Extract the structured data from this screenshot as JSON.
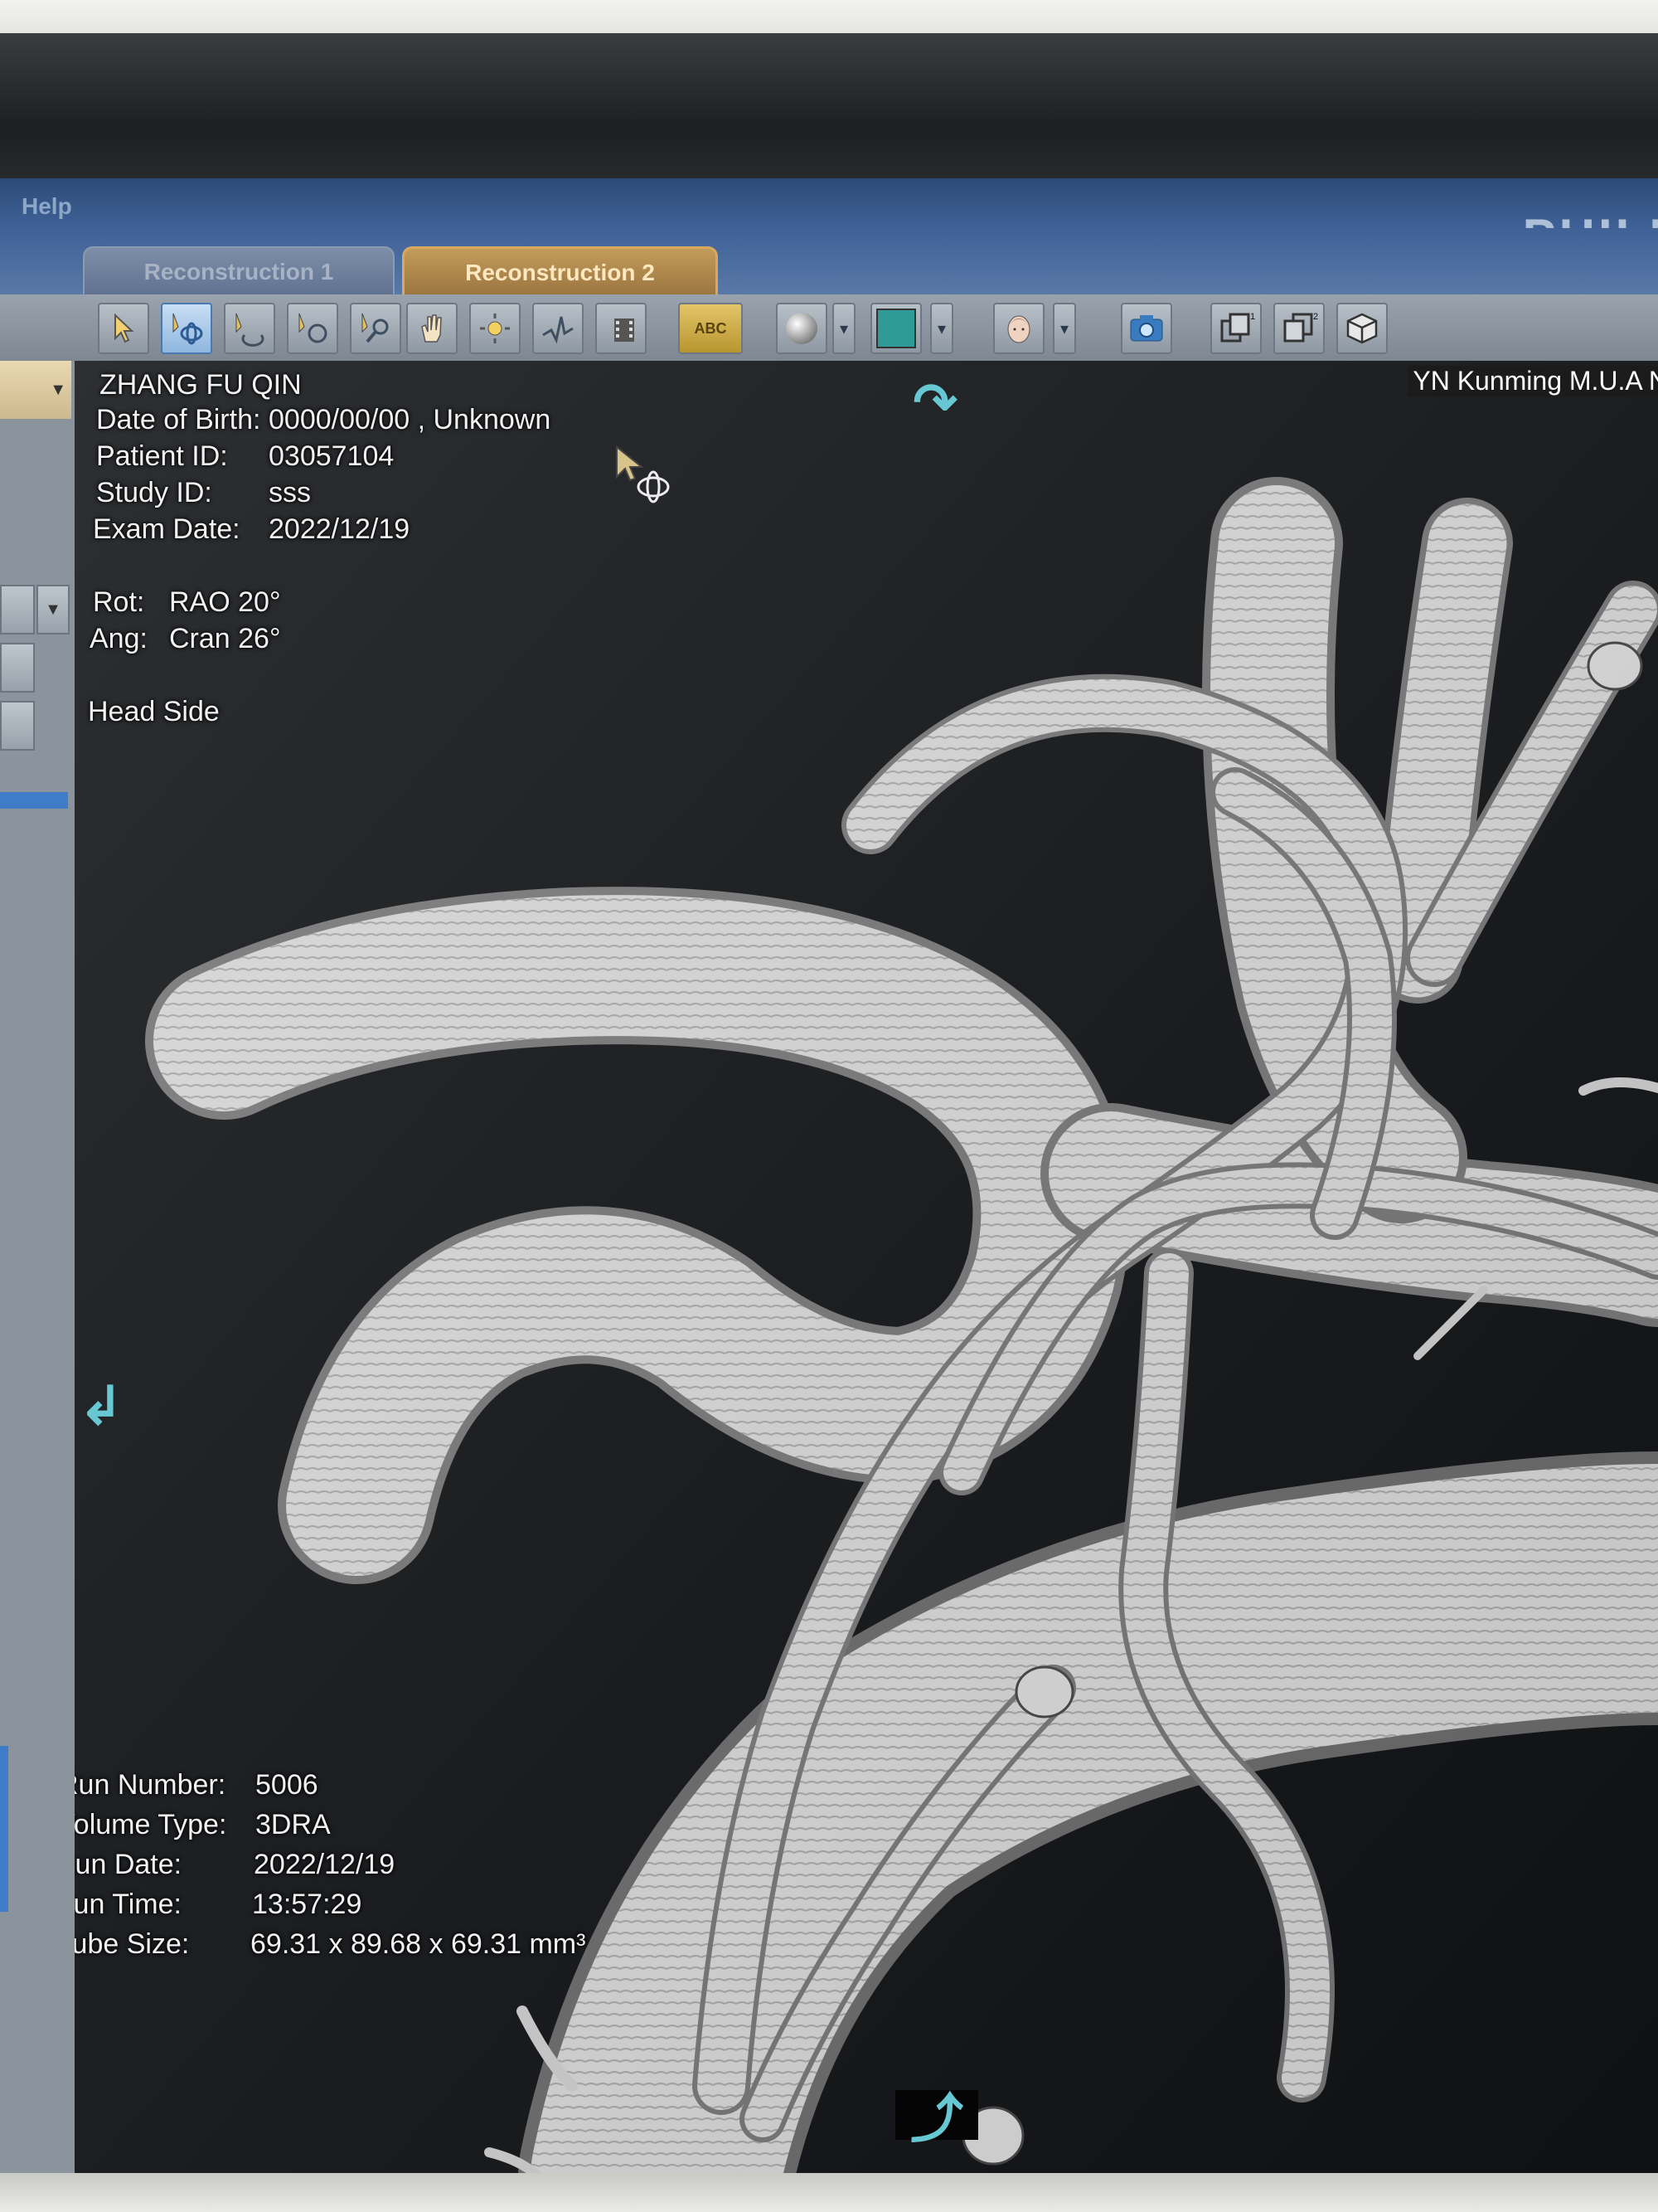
{
  "menu": {
    "help": "Help",
    "brand": "PHILI"
  },
  "tabs": [
    {
      "label": "Reconstruction 1",
      "active": false
    },
    {
      "label": "Reconstruction 2",
      "active": true
    }
  ],
  "toolbar": {
    "abc_label": "ABC",
    "icons": [
      "pointer-icon",
      "rotate-3d-icon",
      "roll-icon",
      "spin-icon",
      "zoom-icon",
      "pan-hand-icon",
      "brightness-icon",
      "measure-icon",
      "movie-icon",
      "text-annotation-icon",
      "render-sphere-icon",
      "color-swatch-icon",
      "head-orientation-icon",
      "camera-icon",
      "layout-1-icon",
      "layout-2-icon",
      "cube-icon"
    ],
    "layout_1_label": "1",
    "layout_2_label": "2",
    "accent_color": "#2f9a96"
  },
  "patient": {
    "name": "ZHANG FU QIN",
    "dob_label": "Date of Birth:",
    "dob_value": "0000/00/00 , Unknown",
    "id_label": "Patient ID:",
    "id_value": "03057104",
    "study_label": "Study ID:",
    "study_value": "sss",
    "exam_label": "Exam Date:",
    "exam_value": "2022/12/19"
  },
  "orientation": {
    "rot_label": "Rot:",
    "rot_value": "RAO  20°",
    "ang_label": "Ang:",
    "ang_value": "Cran  26°",
    "side": "Head Side"
  },
  "site": "YN Kunming M.U.A N",
  "run": {
    "number_label": "Run Number:",
    "number_value": "5006",
    "volume_label": "Volume Type:",
    "volume_value": "3DRA",
    "date_label": "Run Date:",
    "date_value": "2022/12/19",
    "time_label": "Run Time:",
    "time_value": "13:57:29",
    "cube_label": "Cube Size:",
    "cube_value": "69.31 x 89.68 x 69.31 mm³"
  },
  "colors": {
    "rotate_arrow": "#67c7d3",
    "active_tab": "#c39b5a",
    "selection_blue": "#4b79b8"
  }
}
